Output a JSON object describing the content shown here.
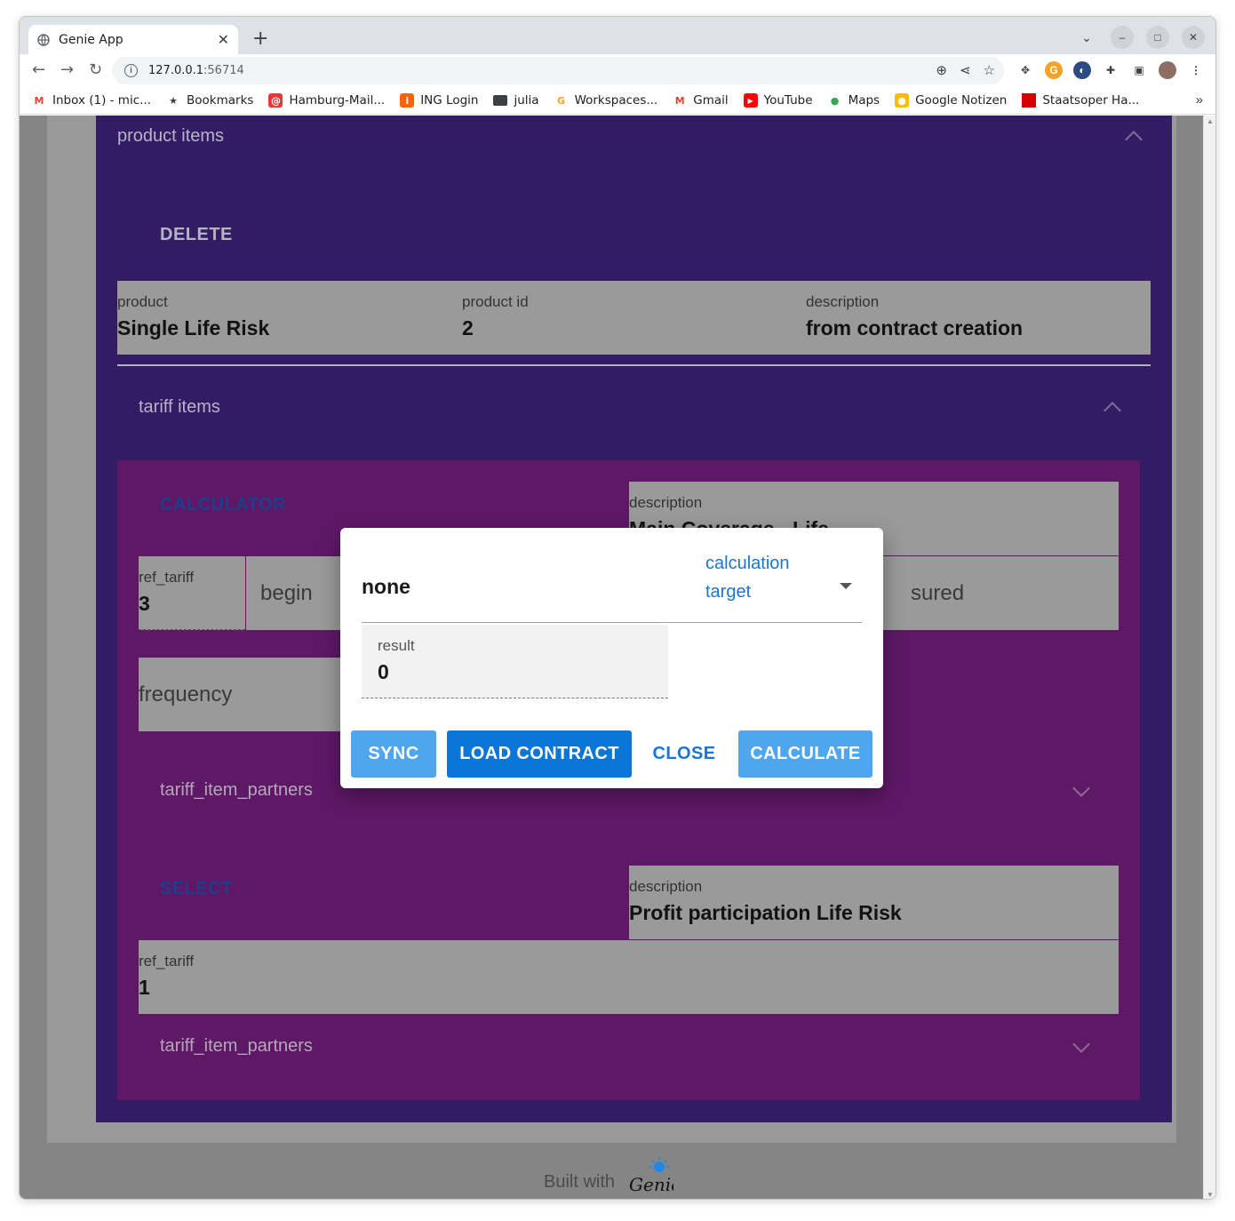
{
  "browser": {
    "tab_title": "Genie App",
    "tab_close": "✕",
    "new_tab": "+",
    "url_host": "127.0.0.1",
    "url_port": ":56714",
    "bookmarks": [
      {
        "label": "Inbox (1) - mic...",
        "icon": "gmail-icon",
        "color": "#ea4335",
        "glyph": "M"
      },
      {
        "label": "Bookmarks",
        "icon": "star-icon",
        "color": "#ffffff",
        "glyph": "★"
      },
      {
        "label": "Hamburg-Mail...",
        "icon": "mail-icon",
        "color": "#e53935",
        "glyph": "@"
      },
      {
        "label": "ING Login",
        "icon": "ing-icon",
        "color": "#ff6200",
        "glyph": "i"
      },
      {
        "label": "julia",
        "icon": "folder-icon",
        "color": "#3c4043",
        "glyph": ""
      },
      {
        "label": "Workspaces...",
        "icon": "workspaces-icon",
        "color": "#f4a326",
        "glyph": "G"
      },
      {
        "label": "Gmail",
        "icon": "gmail-icon",
        "color": "#ea4335",
        "glyph": "M"
      },
      {
        "label": "YouTube",
        "icon": "youtube-icon",
        "color": "#ff0000",
        "glyph": "▶"
      },
      {
        "label": "Maps",
        "icon": "maps-icon",
        "color": "#34a853",
        "glyph": "●"
      },
      {
        "label": "Google Notizen",
        "icon": "keep-icon",
        "color": "#fbbc04",
        "glyph": "●"
      },
      {
        "label": "Staatsoper Ha...",
        "icon": "staatsoper-icon",
        "color": "#d50000",
        "glyph": ""
      }
    ],
    "bookmarks_more": "»"
  },
  "page": {
    "product_items_header": "product items",
    "delete_label": "DELETE",
    "product": {
      "label": "product",
      "value": "Single Life Risk"
    },
    "product_id": {
      "label": "product id",
      "value": "2"
    },
    "product_description": {
      "label": "description",
      "value": "from contract creation"
    },
    "tariff_items_header": "tariff items",
    "tariff_item_1": {
      "button": "CALCULATOR",
      "description_label": "description",
      "description_value": "Main Coverage - Life",
      "ref_tariff_label": "ref_tariff",
      "ref_tariff_value": "3",
      "begin_placeholder": "begin",
      "insured_placeholder": "sured",
      "frequency_placeholder": "frequency",
      "partners_header": "tariff_item_partners"
    },
    "tariff_item_2": {
      "button": "SELECT",
      "description_label": "description",
      "description_value": "Profit participation Life Risk",
      "ref_tariff_label": "ref_tariff",
      "ref_tariff_value": "1",
      "partners_header": "tariff_item_partners"
    },
    "footer_text": "Built with",
    "footer_logo": "Genie"
  },
  "dialog": {
    "calculation_target_value": "none",
    "calculation_target_label": "calculation target",
    "result_label": "result",
    "result_value": "0",
    "buttons": {
      "sync": "SYNC",
      "load_contract": "LOAD CONTRACT",
      "close": "CLOSE",
      "calculate": "CALCULATE"
    }
  },
  "colors": {
    "outer_panel": "#321c63",
    "inner_panel": "#5e1866",
    "primary": "#1976d2",
    "overlay_grey": "#858585"
  }
}
